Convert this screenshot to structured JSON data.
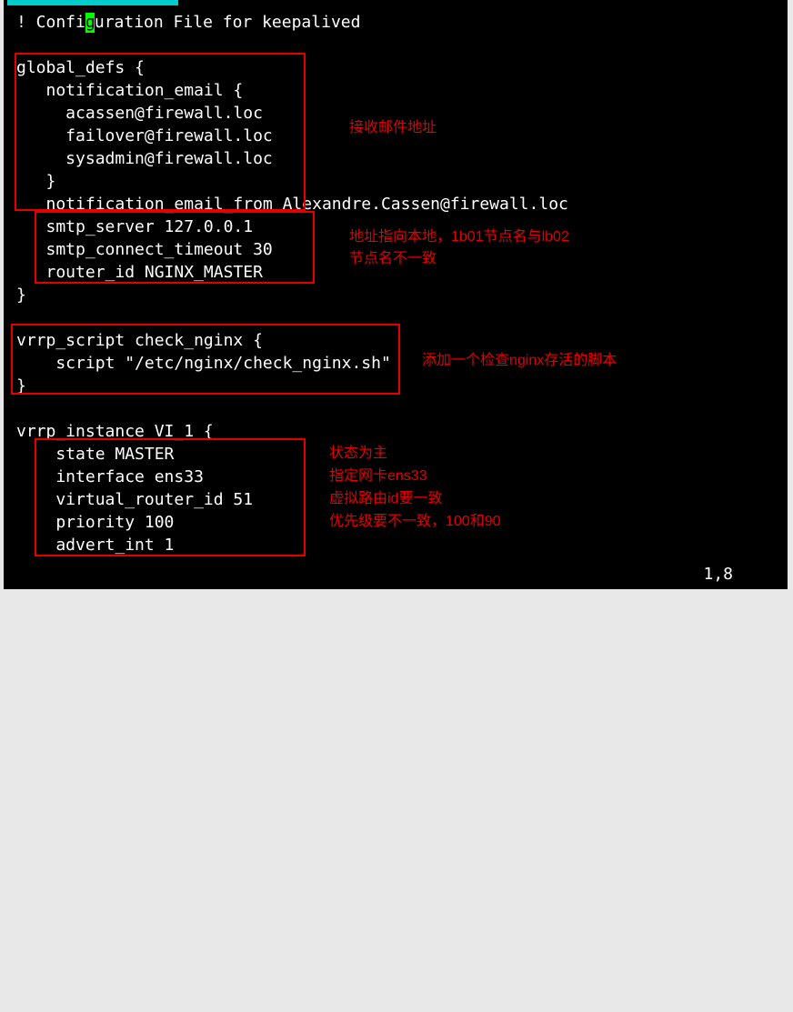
{
  "terminal": {
    "title_before_cursor": "! Confi",
    "cursor_char": "g",
    "title_after_cursor": "uration File for keepalived",
    "lines": {
      "l01": "",
      "l02": "global_defs {",
      "l03": "   notification_email {",
      "l04": "     acassen@firewall.loc",
      "l05": "     failover@firewall.loc",
      "l06": "     sysadmin@firewall.loc",
      "l07": "   }",
      "l08": "   notification_email_from Alexandre.Cassen@firewall.loc",
      "l09": "   smtp_server 127.0.0.1",
      "l10": "   smtp_connect_timeout 30",
      "l11": "   router_id NGINX_MASTER",
      "l12": "}",
      "l13": "",
      "l14": "vrrp_script check_nginx {",
      "l15": "    script \"/etc/nginx/check_nginx.sh\"",
      "l16": "}",
      "l17": "",
      "l18": "vrrp_instance VI_1 {",
      "l19": "    state MASTER",
      "l20": "    interface ens33",
      "l21": "    virtual_router_id 51",
      "l22": "    priority 100",
      "l23": "    advert_int 1"
    },
    "status": "1,8"
  },
  "annotations": {
    "ann1": "接收邮件地址",
    "ann2_line1": "地址指向本地，1b01节点名与lb02",
    "ann2_line2": "节点名不一致",
    "ann3": "添加一个检查nginx存活的脚本",
    "ann4_line1": "状态为主",
    "ann4_line2": "指定网卡ens33",
    "ann4_line3": "虚拟路由id要一致",
    "ann4_line4": "优先级要不一致，100和90"
  }
}
